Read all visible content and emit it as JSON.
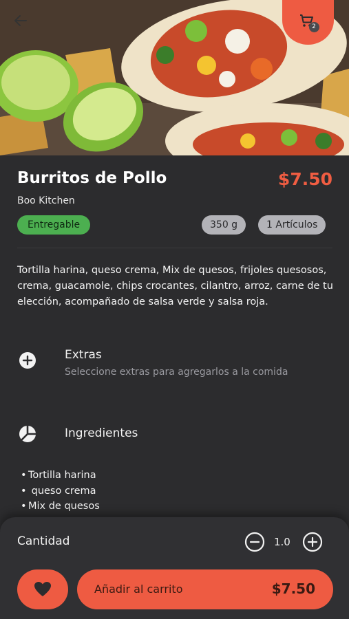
{
  "header": {
    "back_icon": "arrow-left-icon",
    "cart_icon": "shopping-cart-icon",
    "cart_count": "2"
  },
  "product": {
    "name": "Burritos de Pollo",
    "price": "$7.50",
    "vendor": "Boo Kitchen",
    "status": "Entregable",
    "weight": "350 g",
    "items": "1 Artículos",
    "description": "Tortilla harina, queso crema, Mix de quesos, frijoles quesosos, crema, guacamole, chips crocantes, cilantro, arroz, carne de tu elección, acompañado de salsa verde y salsa roja."
  },
  "extras": {
    "icon": "plus-circle-icon",
    "title": "Extras",
    "subtitle": "Seleccione extras para agregarlos a la comida"
  },
  "ingredients": {
    "icon": "pie-chart-icon",
    "title": "Ingredientes",
    "items": [
      "Tortilla harina",
      " queso crema",
      "Mix de quesos"
    ]
  },
  "bottom": {
    "quantity_label": "Cantidad",
    "quantity_value": "1.0",
    "minus_icon": "minus-circle-icon",
    "plus_icon": "plus-circle-icon",
    "favorite_icon": "heart-icon",
    "add_label": "Añadir al carrito",
    "add_price": "$7.50"
  },
  "colors": {
    "background": "#2c2c2e",
    "accent": "#ee5b42",
    "price": "#f05d42",
    "status_green": "#4caf50",
    "pill_grey": "#b3b3b8"
  }
}
